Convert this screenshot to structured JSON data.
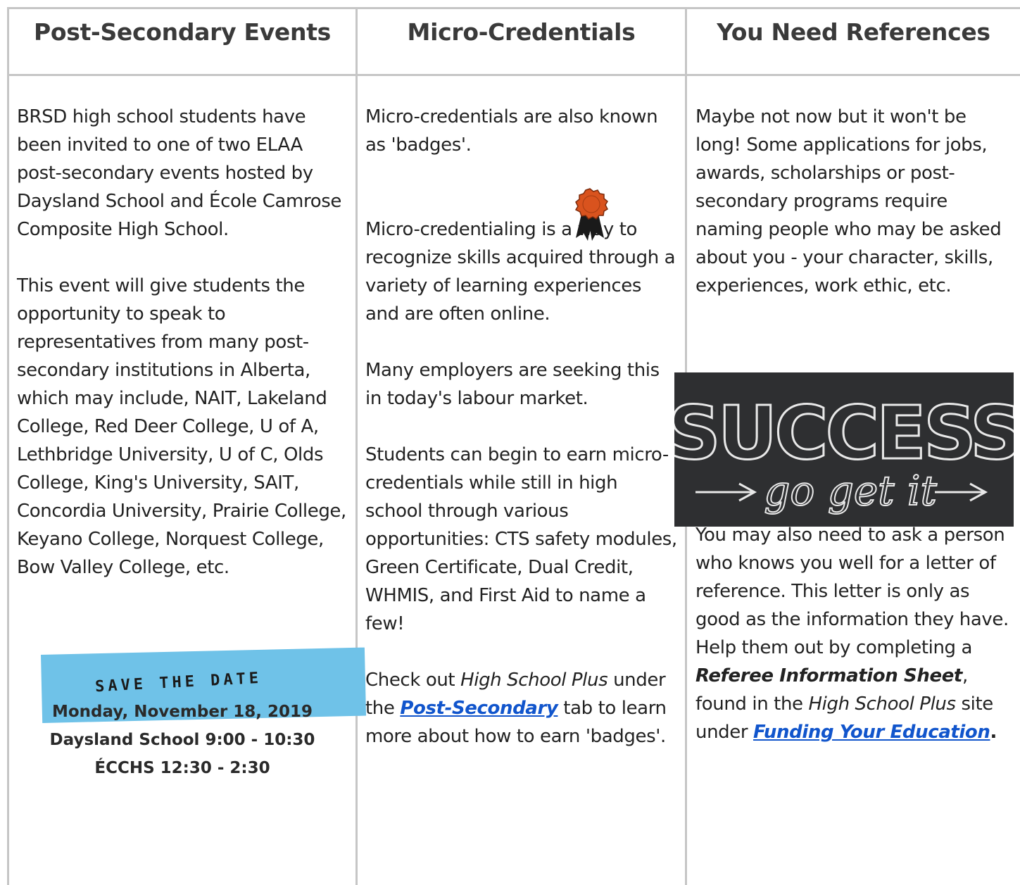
{
  "columns": [
    {
      "title": "Post-Secondary Events",
      "paragraphs": [
        "BRSD high school students have been invited to one of two ELAA post-secondary events hosted by Daysland School and École Camrose Composite High School.",
        "This event will give students the opportunity to speak to representatives from many post-secondary institutions in Alberta, which may include, NAIT, Lakeland College, Red Deer College, U of A, Lethbridge University, U of C,  Olds College, King's University, SAIT, Concordia University, Prairie College, Keyano College, Norquest College, Bow Valley College, etc."
      ],
      "banner": "SAVE THE DATE",
      "date": "Monday, November 18, 2019",
      "sessions": [
        "Daysland School 9:00 - 10:30",
        "ÉCCHS 12:30 - 2:30"
      ]
    },
    {
      "title": "Micro-Credentials",
      "p1": "Micro-credentials are also known as 'badges'.",
      "p2": "Micro-credentialing is a way to recognize skills acquired through a variety of learning experiences and are often online.",
      "p3": "Many employers are seeking this in today's labour market.",
      "p4": "Students can begin to earn micro-credentials while still in high school through various opportunities: CTS safety modules, Green Certificate, Dual Credit, WHMIS, and First Aid to name a few!",
      "p5": {
        "prefix": "Check out ",
        "site": "High School Plus",
        "middle": " under the ",
        "link": "Post-Secondary",
        "suffix": " tab to learn more about how to earn 'badges'."
      }
    },
    {
      "title": "You Need References",
      "p1": "Maybe not now but it won't be long! Some applications for jobs, awards, scholarships or post-secondary programs require naming people who may be asked about you - your character, skills, experiences, work ethic, etc.",
      "image_text": [
        "SUCCESS",
        "go get it"
      ],
      "p2": {
        "prefix": "You may also need to ask a person who knows you well for a letter of reference. This letter is only as good as the information they have. Help them out by completing a ",
        "bold": "Referee Information Sheet",
        "middle": ", found in the ",
        "site": "High School Plus",
        "middle2": " site under ",
        "link": "Funding Your Education",
        "suffix": "."
      }
    }
  ],
  "colors": {
    "border": "#c6c6c6",
    "heading": "#3a3a3a",
    "link": "#1155cc",
    "banner": "#6fc2e8",
    "badge": "#d9531e"
  },
  "icons": [
    "award-ribbon-icon"
  ]
}
